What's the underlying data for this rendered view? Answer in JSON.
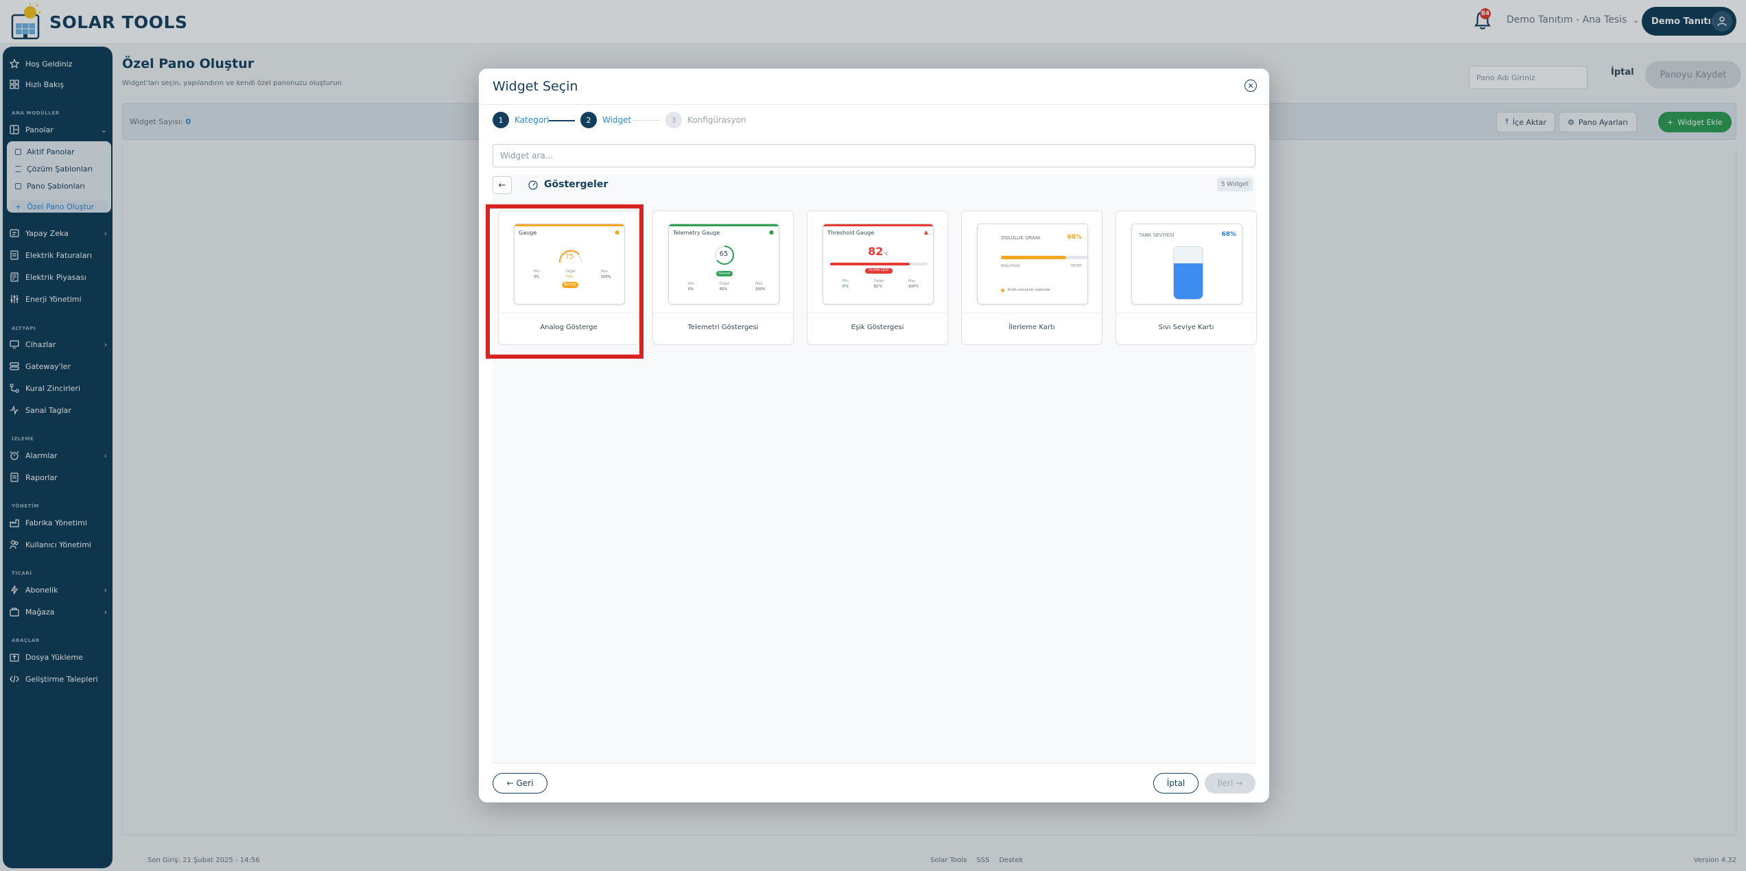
{
  "app": {
    "brand": "SOLAR TOOLS"
  },
  "header": {
    "notification_count": "84",
    "tenant": "Demo Tanıtım - Ana Tesis",
    "user": "Demo Tanıtım"
  },
  "sidebar": {
    "home": "Hoş Geldiniz",
    "quick": "Hızlı Bakış",
    "section_main": "ANA MODÜLLER",
    "dashboards": "Panolar",
    "sub": [
      "Aktif Panolar",
      "Çözüm Şablonları",
      "Pano Şablonları",
      "Özel Pano Oluştur"
    ],
    "ai": "Yapay Zeka",
    "bills": "Elektrik Faturaları",
    "market": "Elektrik Piyasası",
    "energy": "Enerji Yönetimi",
    "section_infra": "ALTYAPI",
    "devices": "Cihazlar",
    "gateways": "Gateway'ler",
    "rules": "Kural Zincirleri",
    "virtual": "Sanal Taglar",
    "section_monitor": "İZLEME",
    "alarms": "Alarmlar",
    "reports": "Raporlar",
    "section_admin": "YÖNETİM",
    "factory": "Fabrika Yönetimi",
    "users": "Kullanıcı Yönetimi",
    "section_commerce": "TİCARİ",
    "subscription": "Abonelik",
    "store": "Mağaza",
    "section_tools": "ARAÇLAR",
    "upload": "Dosya Yükleme",
    "dev_requests": "Geliştirme Talepleri"
  },
  "page": {
    "title": "Özel Pano Oluştur",
    "subtitle": "Widget'ları seçin, yapılandırın ve kendi özel panonuzu oluşturun",
    "name_placeholder": "Pano Adı Giriniz",
    "cancel": "İptal",
    "save": "Panoyu Kaydet",
    "widget_count_label": "Widget Sayısı:",
    "widget_count": "0",
    "import": "İçe Aktar",
    "settings": "Pano Ayarları",
    "add_widget": "Widget Ekle"
  },
  "footer": {
    "last_login": "Son Giriş: 21 Şubat 2025 - 14:56",
    "links": [
      "Solar Tools",
      "SSS",
      "Destek"
    ],
    "version": "Version 4.32"
  },
  "modal": {
    "title": "Widget Seçin",
    "steps": [
      {
        "num": "1",
        "label": "Kategori"
      },
      {
        "num": "2",
        "label": "Widget"
      },
      {
        "num": "3",
        "label": "Konfigürasyon"
      }
    ],
    "search_placeholder": "Widget ara...",
    "category": "Göstergeler",
    "count": "5 Widget",
    "back": "← Geri",
    "cancel": "İptal",
    "next": "İleri →",
    "widgets": [
      {
        "name": "Analog Gösterge",
        "preview_title": "Gauge",
        "value": "75",
        "status": "Normal",
        "accent": "#f5a623",
        "labels": [
          "Min",
          "Değer",
          "Max"
        ],
        "stats": [
          "0%",
          "75%",
          "100%"
        ]
      },
      {
        "name": "Telemetri Göstergesi",
        "preview_title": "Telemetry Gauge",
        "value": "65",
        "status": "Güncel",
        "accent": "#2e9e52",
        "labels": [
          "Min",
          "Değer",
          "Max"
        ],
        "stats": [
          "0%",
          "65%",
          "100%"
        ]
      },
      {
        "name": "Eşik Göstergesi",
        "preview_title": "Threshold Gauge",
        "value": "82",
        "unit": "°C",
        "status": "ALARM EŞİĞİ",
        "accent": "#e53935",
        "labels": [
          "Min",
          "Değer",
          "Max"
        ],
        "stats": [
          "0°C",
          "82°C",
          "100°C"
        ]
      },
      {
        "name": "İlerleme Kartı",
        "preview_title": "DOLULUK ORANI",
        "value": "68%",
        "progress": 0.68,
        "accent": "#f5a623",
        "labels": [
          "BAŞLANGIÇ",
          "HEDEF"
        ],
        "note": "Kritik seviyenin üzerinde"
      },
      {
        "name": "Sıvı Seviye Kartı",
        "preview_title": "TANK SEVİYESİ",
        "value": "68%",
        "level": 0.68,
        "accent": "#2f80ed"
      }
    ]
  }
}
